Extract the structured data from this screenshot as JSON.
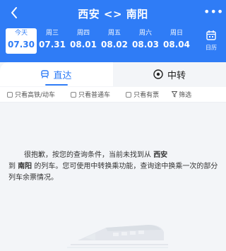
{
  "header": {
    "title": "西安 <> 南阳",
    "more_label": "•••"
  },
  "dates": [
    {
      "weekday": "今天",
      "date": "07.30",
      "selected": true
    },
    {
      "weekday": "周三",
      "date": "07.31",
      "selected": false
    },
    {
      "weekday": "周四",
      "date": "08.01",
      "selected": false
    },
    {
      "weekday": "周五",
      "date": "08.02",
      "selected": false
    },
    {
      "weekday": "周六",
      "date": "08.03",
      "selected": false
    },
    {
      "weekday": "周日",
      "date": "08.04",
      "selected": false
    }
  ],
  "calendar": {
    "label": "日历"
  },
  "tabs": {
    "direct": "直达",
    "transfer": "中转"
  },
  "filters": {
    "high_speed": "只看高铁/动车",
    "normal": "只看普通车",
    "tickets": "只看有票",
    "filter": "筛选"
  },
  "empty": {
    "part1": "很抱歉，按您的查询条件，当前未找到从",
    "origin": "西安",
    "part2": "到",
    "destination": "南阳",
    "part3": "的列车。您可使用中转换乘功能，查询途中换乘一次的部分列车余票情况。"
  },
  "colors": {
    "accent": "#2f7cf6",
    "background": "#f3f5f8"
  }
}
